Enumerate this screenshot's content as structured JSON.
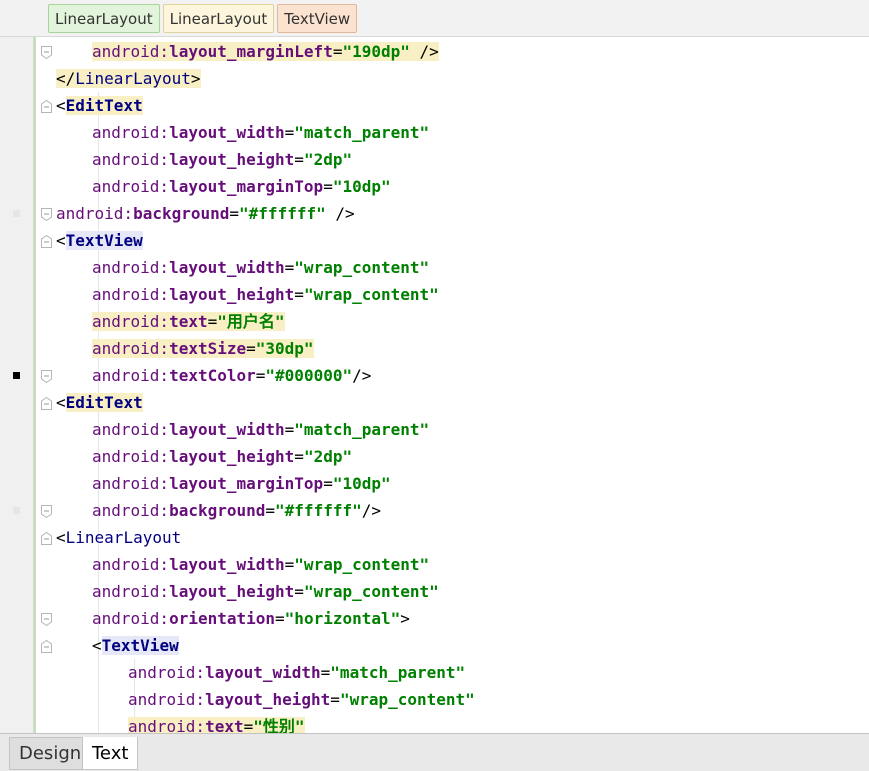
{
  "breadcrumbs": [
    {
      "label": "LinearLayout",
      "style": "green"
    },
    {
      "label": "LinearLayout",
      "style": "yellow"
    },
    {
      "label": "TextView",
      "style": "orange"
    }
  ],
  "code_lines": [
    {
      "indent": 2,
      "marker": "none",
      "fold": "end",
      "tokens": [
        [
          "ns",
          "android:"
        ],
        [
          "attr",
          "layout_marginLeft"
        ],
        [
          "eq",
          "="
        ],
        [
          "val",
          "\"190dp\""
        ],
        [
          "pun",
          " />"
        ]
      ],
      "hl_all": true
    },
    {
      "indent": 1,
      "marker": "none",
      "fold": "none",
      "tokens": [
        [
          "br",
          "</"
        ],
        [
          "tagn",
          "LinearLayout"
        ],
        [
          "br",
          ">"
        ]
      ],
      "hl_all": true
    },
    {
      "indent": 1,
      "marker": "none",
      "fold": "start",
      "tokens": [
        [
          "br",
          "<"
        ],
        [
          "tag",
          "EditText",
          "hl"
        ]
      ]
    },
    {
      "indent": 2,
      "marker": "none",
      "fold": "none",
      "tokens": [
        [
          "ns",
          "android:"
        ],
        [
          "attr",
          "layout_width"
        ],
        [
          "eq",
          "="
        ],
        [
          "val",
          "\"match_parent\""
        ]
      ]
    },
    {
      "indent": 2,
      "marker": "none",
      "fold": "none",
      "tokens": [
        [
          "ns",
          "android:"
        ],
        [
          "attr",
          "layout_height"
        ],
        [
          "eq",
          "="
        ],
        [
          "val",
          "\"2dp\""
        ]
      ]
    },
    {
      "indent": 2,
      "marker": "none",
      "fold": "none",
      "tokens": [
        [
          "ns",
          "android:"
        ],
        [
          "attr",
          "layout_marginTop"
        ],
        [
          "eq",
          "="
        ],
        [
          "val",
          "\"10dp\""
        ]
      ]
    },
    {
      "indent": 1,
      "marker": "grey",
      "fold": "end",
      "tokens": [
        [
          "ns",
          "android:"
        ],
        [
          "attr",
          "background"
        ],
        [
          "eq",
          "="
        ],
        [
          "val",
          "\"#ffffff\""
        ],
        [
          "pun",
          " />"
        ]
      ]
    },
    {
      "indent": 1,
      "marker": "none",
      "fold": "start",
      "tokens": [
        [
          "br",
          "<"
        ],
        [
          "tag",
          "TextView",
          "hlb"
        ]
      ]
    },
    {
      "indent": 2,
      "marker": "none",
      "fold": "none",
      "tokens": [
        [
          "ns",
          "android:"
        ],
        [
          "attr",
          "layout_width"
        ],
        [
          "eq",
          "="
        ],
        [
          "val",
          "\"wrap_content\""
        ]
      ]
    },
    {
      "indent": 2,
      "marker": "none",
      "fold": "none",
      "tokens": [
        [
          "ns",
          "android:"
        ],
        [
          "attr",
          "layout_height"
        ],
        [
          "eq",
          "="
        ],
        [
          "val",
          "\"wrap_content\""
        ]
      ]
    },
    {
      "indent": 2,
      "marker": "none",
      "fold": "none",
      "tokens": [
        [
          "ns",
          "android:"
        ],
        [
          "attr",
          "text"
        ],
        [
          "eq",
          "="
        ],
        [
          "val",
          "\"用户名\""
        ]
      ],
      "hl_all": true
    },
    {
      "indent": 2,
      "marker": "none",
      "fold": "none",
      "tokens": [
        [
          "ns",
          "android:"
        ],
        [
          "attr",
          "textSize"
        ],
        [
          "eq",
          "="
        ],
        [
          "val",
          "\"30dp\""
        ]
      ],
      "hl_all": true
    },
    {
      "indent": 2,
      "marker": "black",
      "fold": "end",
      "tokens": [
        [
          "ns",
          "android:"
        ],
        [
          "attr",
          "textColor"
        ],
        [
          "eq",
          "="
        ],
        [
          "val",
          "\"#000000\""
        ],
        [
          "pun",
          "/>"
        ]
      ]
    },
    {
      "indent": 1,
      "marker": "none",
      "fold": "start",
      "tokens": [
        [
          "br",
          "<"
        ],
        [
          "tag",
          "EditText",
          "hl"
        ]
      ]
    },
    {
      "indent": 2,
      "marker": "none",
      "fold": "none",
      "tokens": [
        [
          "ns",
          "android:"
        ],
        [
          "attr",
          "layout_width"
        ],
        [
          "eq",
          "="
        ],
        [
          "val",
          "\"match_parent\""
        ]
      ]
    },
    {
      "indent": 2,
      "marker": "none",
      "fold": "none",
      "tokens": [
        [
          "ns",
          "android:"
        ],
        [
          "attr",
          "layout_height"
        ],
        [
          "eq",
          "="
        ],
        [
          "val",
          "\"2dp\""
        ]
      ]
    },
    {
      "indent": 2,
      "marker": "none",
      "fold": "none",
      "tokens": [
        [
          "ns",
          "android:"
        ],
        [
          "attr",
          "layout_marginTop"
        ],
        [
          "eq",
          "="
        ],
        [
          "val",
          "\"10dp\""
        ]
      ]
    },
    {
      "indent": 2,
      "marker": "grey",
      "fold": "end",
      "tokens": [
        [
          "ns",
          "android:"
        ],
        [
          "attr",
          "background"
        ],
        [
          "eq",
          "="
        ],
        [
          "val",
          "\"#ffffff\""
        ],
        [
          "pun",
          "/>"
        ]
      ]
    },
    {
      "indent": 1,
      "marker": "none",
      "fold": "start",
      "tokens": [
        [
          "br",
          "<"
        ],
        [
          "tagn",
          "LinearLayout"
        ]
      ]
    },
    {
      "indent": 2,
      "marker": "none",
      "fold": "none",
      "tokens": [
        [
          "ns",
          "android:"
        ],
        [
          "attr",
          "layout_width"
        ],
        [
          "eq",
          "="
        ],
        [
          "val",
          "\"wrap_content\""
        ]
      ]
    },
    {
      "indent": 2,
      "marker": "none",
      "fold": "none",
      "tokens": [
        [
          "ns",
          "android:"
        ],
        [
          "attr",
          "layout_height"
        ],
        [
          "eq",
          "="
        ],
        [
          "val",
          "\"wrap_content\""
        ]
      ]
    },
    {
      "indent": 2,
      "marker": "none",
      "fold": "end",
      "tokens": [
        [
          "ns",
          "android:"
        ],
        [
          "attr",
          "orientation"
        ],
        [
          "eq",
          "="
        ],
        [
          "val",
          "\"horizontal\""
        ],
        [
          "br",
          ">"
        ]
      ]
    },
    {
      "indent": 2,
      "marker": "none",
      "fold": "start",
      "tokens": [
        [
          "br",
          "<"
        ],
        [
          "tag",
          "TextView",
          "hlb"
        ]
      ]
    },
    {
      "indent": 3,
      "marker": "none",
      "fold": "none",
      "tokens": [
        [
          "ns",
          "android:"
        ],
        [
          "attr",
          "layout_width"
        ],
        [
          "eq",
          "="
        ],
        [
          "val",
          "\"match_parent\""
        ]
      ]
    },
    {
      "indent": 3,
      "marker": "none",
      "fold": "none",
      "tokens": [
        [
          "ns",
          "android:"
        ],
        [
          "attr",
          "layout_height"
        ],
        [
          "eq",
          "="
        ],
        [
          "val",
          "\"wrap_content\""
        ]
      ]
    },
    {
      "indent": 3,
      "marker": "none",
      "fold": "none",
      "tokens": [
        [
          "ns",
          "android:"
        ],
        [
          "attr",
          "text"
        ],
        [
          "eq",
          "="
        ],
        [
          "val",
          "\"性别\""
        ]
      ],
      "hl_all": true
    }
  ],
  "bottom_tabs": [
    {
      "label": "Design",
      "active": false
    },
    {
      "label": "Text",
      "active": true
    }
  ],
  "colors": {
    "tag": "#000080",
    "attribute": "#660e7a",
    "value": "#008000",
    "highlight": "#f8efc4"
  }
}
